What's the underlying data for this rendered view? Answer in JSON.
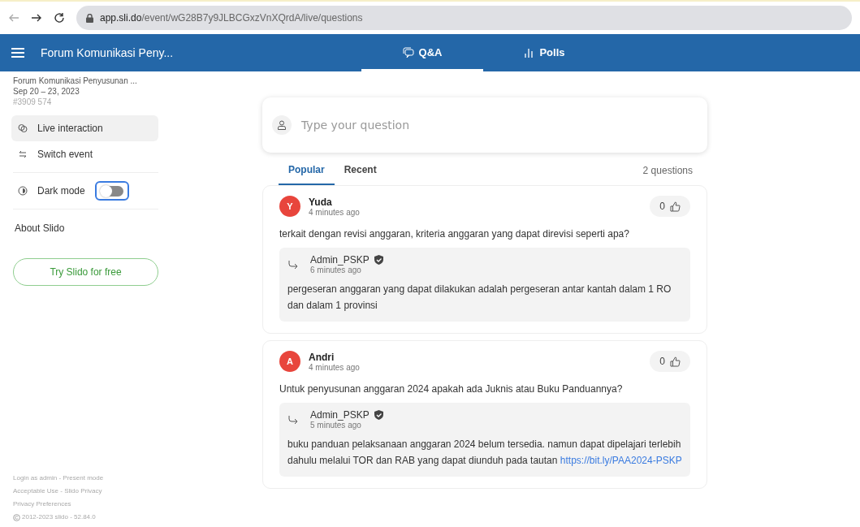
{
  "browser": {
    "url_host": "app.sli.do",
    "url_path": "/event/wG28B7y9JLBCGxzVnXQrdA/live/questions"
  },
  "header": {
    "title": "Forum Komunikasi Peny...",
    "tabs": [
      {
        "label": "Q&A",
        "selected": true
      },
      {
        "label": "Polls",
        "selected": false
      }
    ]
  },
  "sidebar": {
    "event_name": "Forum Komunikasi Penyusunan ...",
    "dates": "Sep 20 – 23, 2023",
    "code": "#3909 574",
    "items": [
      {
        "label": "Live interaction",
        "selected": true
      },
      {
        "label": "Switch event",
        "selected": false
      }
    ],
    "dark_mode": {
      "label": "Dark mode",
      "on": false
    },
    "about": "About Slido",
    "try_button": "Try Slido for free",
    "footer": [
      "Login as admin - Present mode",
      "Acceptable Use - Slido Privacy",
      "Privacy Preferences",
      "2012-2023 slido - 52.84.0"
    ]
  },
  "question_input": {
    "placeholder": "Type your question"
  },
  "sort_tabs": [
    {
      "label": "Popular",
      "selected": true
    },
    {
      "label": "Recent",
      "selected": false
    }
  ],
  "question_count": "2 questions",
  "questions": [
    {
      "initial": "Y",
      "author": "Yuda",
      "time": "4 minutes ago",
      "likes": "0",
      "text": "terkait dengan revisi anggaran, kriteria anggaran yang dapat direvisi seperti apa?",
      "reply": {
        "author": "Admin_PSKP",
        "time": "6 minutes ago",
        "text": "pergeseran anggaran yang dapat dilakukan adalah pergeseran antar kantah dalam 1 RO dan dalam 1 provinsi"
      }
    },
    {
      "initial": "A",
      "author": "Andri",
      "time": "4 minutes ago",
      "likes": "0",
      "text": "Untuk penyusunan anggaran 2024 apakah ada Juknis atau Buku Panduannya?",
      "reply": {
        "author": "Admin_PSKP",
        "time": "5 minutes ago",
        "text": "buku panduan pelaksanaan anggaran 2024 belum tersedia. namun dapat dipelajari terlebih dahulu melalui TOR dan RAB yang dapat diunduh pada tautan ",
        "link": "https://bit.ly/PAA2024-PSKP"
      }
    }
  ]
}
